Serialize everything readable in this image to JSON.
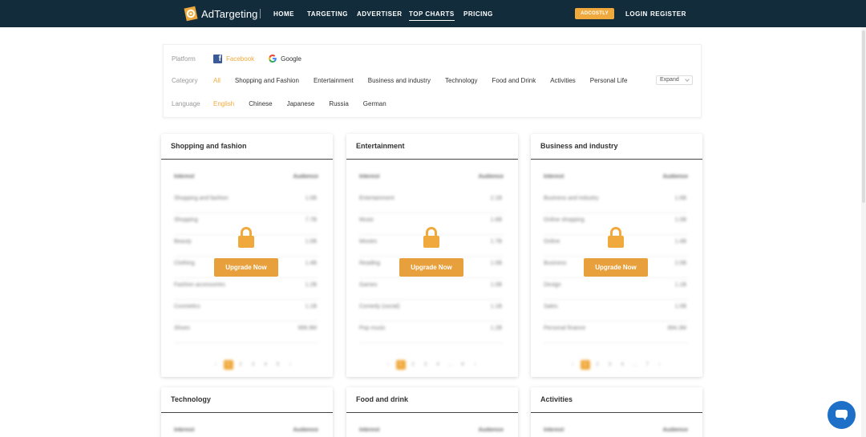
{
  "brand": {
    "name": "AdTargeting",
    "accent": "#f0a93c",
    "nav_bg": "#122c3c",
    "chat_color": "#1e6fc7"
  },
  "nav": {
    "links": [
      "HOME",
      "TARGETING",
      "ADVERTISER",
      "TOP CHARTS",
      "PRICING"
    ],
    "active": "TOP CHARTS",
    "badge": "ADCOSTLY",
    "login": "LOGIN",
    "register": "REGISTER"
  },
  "filters": {
    "platform_label": "Platform",
    "platforms": [
      "Facebook",
      "Google"
    ],
    "platform_selected": "Facebook",
    "category_label": "Category",
    "categories": [
      "All",
      "Shopping and Fashion",
      "Entertainment",
      "Business and industry",
      "Technology",
      "Food and Drink",
      "Activities",
      "Personal Life"
    ],
    "category_selected": "All",
    "expand": "Expand",
    "language_label": "Language",
    "languages": [
      "English",
      "Chinese",
      "Japanese",
      "Russia",
      "German"
    ],
    "language_selected": "English"
  },
  "table_headers": {
    "interest": "Interest",
    "audience": "Audience"
  },
  "upgrade_label": "Upgrade Now",
  "cards": [
    {
      "title": "Shopping and fashion",
      "rows": [
        [
          "Shopping and fashion",
          "1.0B"
        ],
        [
          "Shopping",
          "7.7B"
        ],
        [
          "Beauty",
          "1.0B"
        ],
        [
          "Clothing",
          "1.4B"
        ],
        [
          "Fashion accessories",
          "1.2B"
        ],
        [
          "Cosmetics",
          "1.1B"
        ],
        [
          "Shoes",
          "999.9M"
        ]
      ],
      "pages": [
        "‹",
        "1",
        "2",
        "3",
        "4",
        "5",
        "›"
      ]
    },
    {
      "title": "Entertainment",
      "rows": [
        [
          "Entertainment",
          "2.1B"
        ],
        [
          "Music",
          "1.6B"
        ],
        [
          "Movies",
          "1.7B"
        ],
        [
          "Reading",
          "1.0B"
        ],
        [
          "Games",
          "1.0B"
        ],
        [
          "Comedy (social)",
          "1.1B"
        ],
        [
          "Pop music",
          "1.2B"
        ]
      ],
      "pages": [
        "‹",
        "1",
        "2",
        "3",
        "4",
        "…",
        "6",
        "›"
      ]
    },
    {
      "title": "Business and industry",
      "rows": [
        [
          "Business and industry",
          "1.6B"
        ],
        [
          "Online shopping",
          "1.0B"
        ],
        [
          "Online",
          "1.4B"
        ],
        [
          "Business",
          "2.0B"
        ],
        [
          "Design",
          "1.1B"
        ],
        [
          "Sales",
          "1.0B"
        ],
        [
          "Personal finance",
          "894.3M"
        ]
      ],
      "pages": [
        "‹",
        "1",
        "2",
        "3",
        "4",
        "…",
        "7",
        "›"
      ]
    },
    {
      "title": "Technology"
    },
    {
      "title": "Food and drink"
    },
    {
      "title": "Activities"
    }
  ]
}
